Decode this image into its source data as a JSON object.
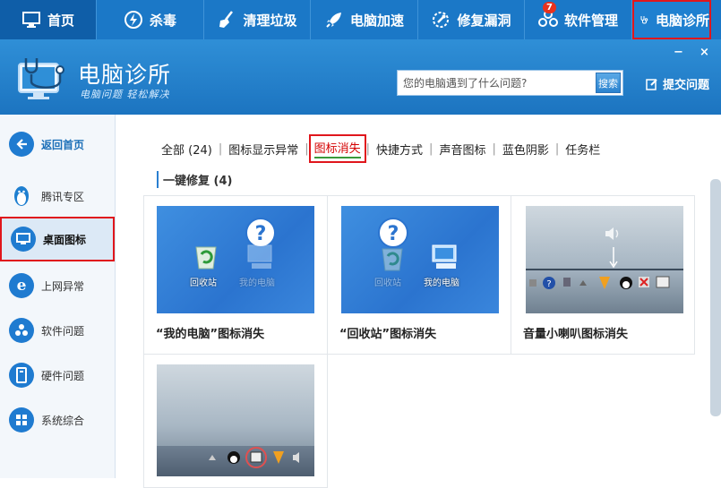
{
  "topnav": {
    "items": [
      {
        "label": "首页",
        "icon": "monitor-icon"
      },
      {
        "label": "杀毒",
        "icon": "shield-bolt-icon"
      },
      {
        "label": "清理垃圾",
        "icon": "broom-icon"
      },
      {
        "label": "电脑加速",
        "icon": "rocket-icon"
      },
      {
        "label": "修复漏洞",
        "icon": "wrench-gear-icon"
      },
      {
        "label": "软件管理",
        "icon": "apps-icon",
        "badge": "7"
      },
      {
        "label": "电脑诊所",
        "icon": "stethoscope-icon"
      }
    ]
  },
  "header": {
    "title": "电脑诊所",
    "slogan": "电脑问题 轻松解决",
    "search_placeholder": "您的电脑遇到了什么问题?",
    "search_button": "搜索",
    "submit_label": "提交问题",
    "minimize": "−",
    "close": "×"
  },
  "sidebar": {
    "items": [
      {
        "label": "返回首页",
        "icon": "back-arrow-icon"
      },
      {
        "label": "腾讯专区",
        "icon": "penguin-icon"
      },
      {
        "label": "桌面图标",
        "icon": "desktop-icon"
      },
      {
        "label": "上网异常",
        "icon": "ie-icon"
      },
      {
        "label": "软件问题",
        "icon": "puzzle-icon"
      },
      {
        "label": "硬件问题",
        "icon": "hardware-icon"
      },
      {
        "label": "系统综合",
        "icon": "windows-icon"
      }
    ]
  },
  "tabs": [
    "全部 (24)",
    "图标显示异常",
    "图标消失",
    "快捷方式",
    "声音图标",
    "蓝色阴影",
    "任务栏"
  ],
  "section_title": "一键修复 (4)",
  "cards": [
    {
      "title": "“我的电脑”图标消失",
      "label_a": "回收站",
      "label_b": "我的电脑"
    },
    {
      "title": "“回收站”图标消失",
      "label_a": "回收站",
      "label_b": "我的电脑"
    },
    {
      "title": "音量小喇叭图标消失"
    },
    {
      "title": ""
    }
  ]
}
